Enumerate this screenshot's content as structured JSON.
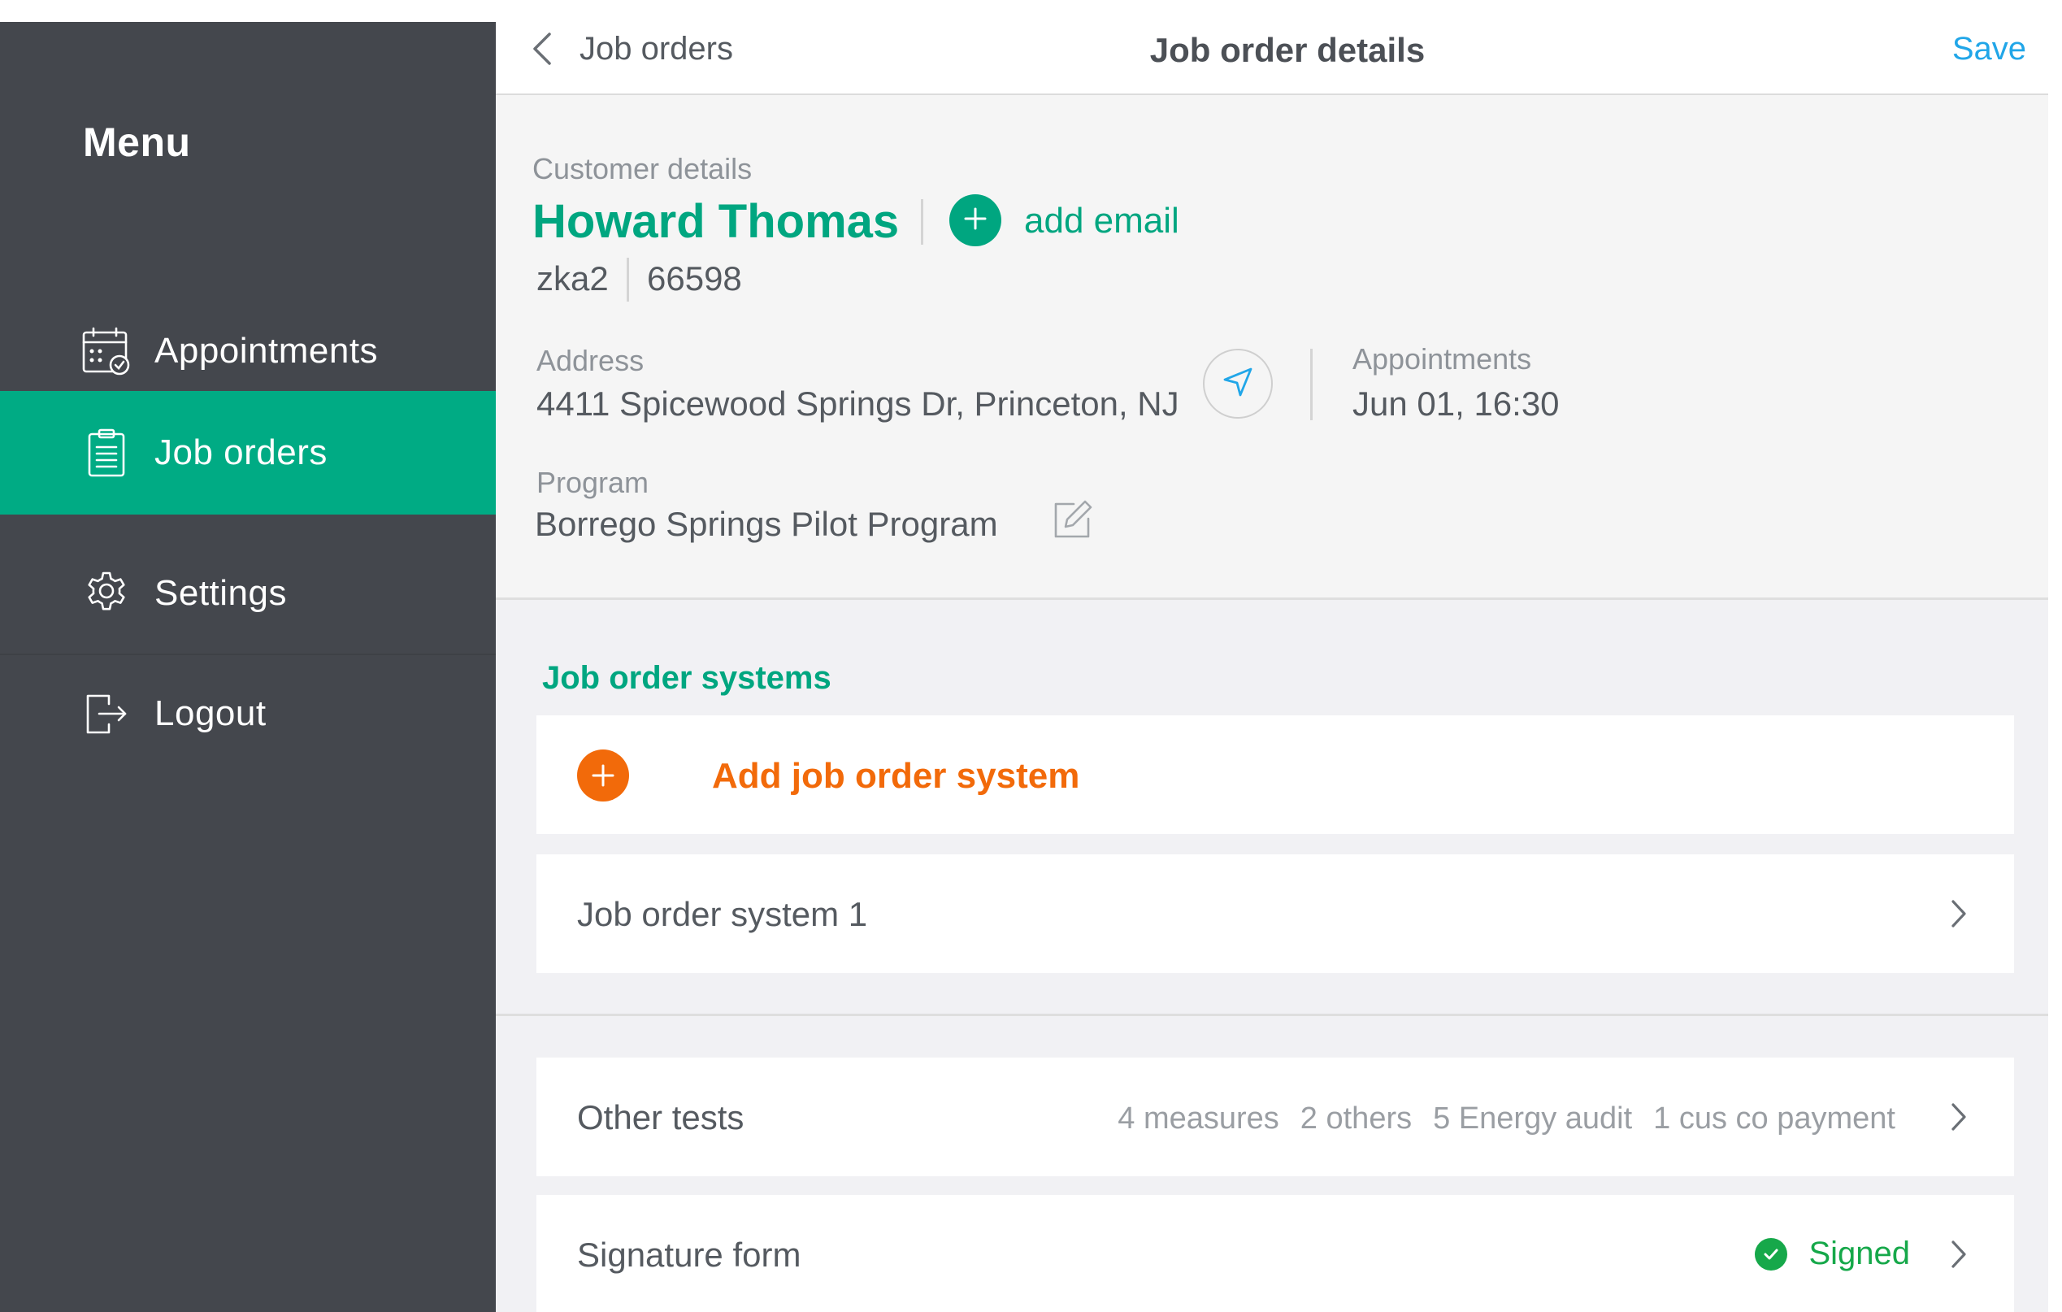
{
  "sidebar": {
    "title": "Menu",
    "items": [
      {
        "label": "Appointments",
        "icon": "calendar-icon",
        "active": false
      },
      {
        "label": "Job orders",
        "icon": "clipboard-icon",
        "active": true
      },
      {
        "label": "Settings",
        "icon": "gear-icon",
        "active": false
      },
      {
        "label": "Logout",
        "icon": "logout-icon",
        "active": false
      }
    ]
  },
  "topbar": {
    "back_label": "Job orders",
    "title": "Job order details",
    "save_label": "Save"
  },
  "customer": {
    "section_label": "Customer details",
    "name": "Howard Thomas",
    "add_email_label": "add email",
    "id": "zka2",
    "zip": "66598",
    "address_label": "Address",
    "address": "4411 Spicewood Springs Dr, Princeton, NJ",
    "appointments_label": "Appointments",
    "appointment": "Jun 01, 16:30",
    "program_label": "Program",
    "program": "Borrego Springs Pilot Program"
  },
  "systems": {
    "title": "Job order systems",
    "add_label": "Add job order system",
    "items": [
      {
        "label": "Job order system 1"
      }
    ]
  },
  "other_tests": {
    "label": "Other tests",
    "summary": [
      "4 measures",
      "2 others",
      "5 Energy audit",
      "1 cus co payment"
    ]
  },
  "signature": {
    "label": "Signature form",
    "status": "Signed"
  },
  "colors": {
    "sidebar_bg": "#44474d",
    "accent_green": "#00ab84",
    "accent_orange": "#f26a0a",
    "link_blue": "#21a6e8",
    "signed_green": "#16a84a"
  }
}
